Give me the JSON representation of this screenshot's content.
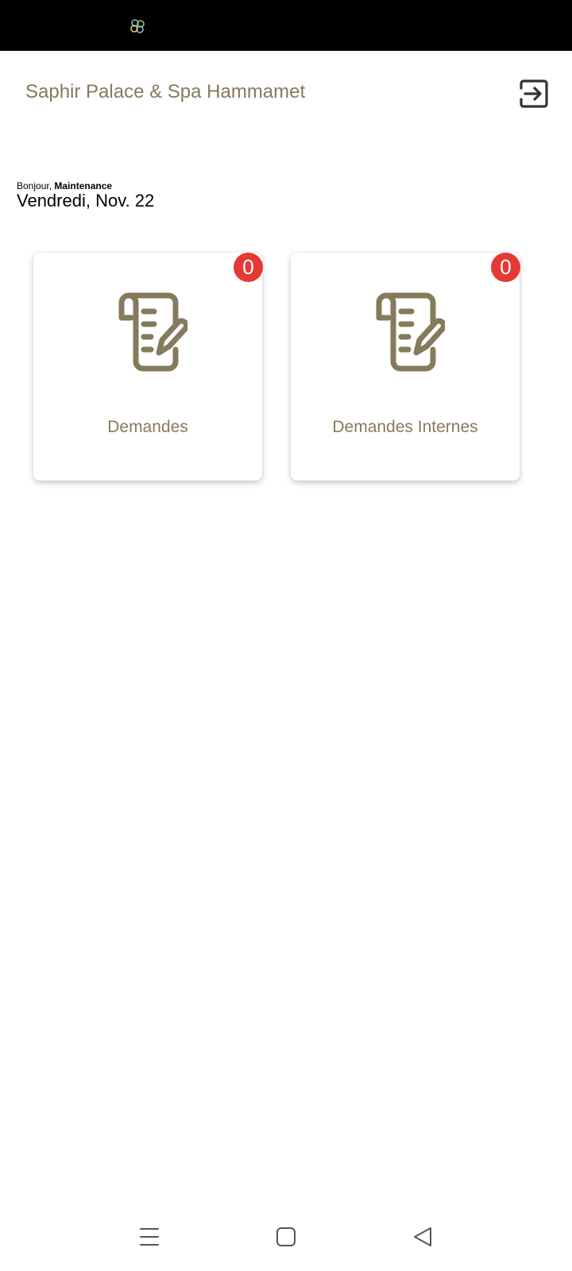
{
  "status_bar": {
    "app_icon": "pinwheel-app-icon"
  },
  "header": {
    "title": "Saphir Palace & Spa Hammamet",
    "logout_icon": "logout-icon"
  },
  "greeting": {
    "prefix": "Bonjour,",
    "name": "Maintenance",
    "date": "Vendredi, Nov. 22"
  },
  "cards": [
    {
      "label": "Demandes",
      "badge": "0",
      "icon": "document-edit-icon"
    },
    {
      "label": "Demandes Internes",
      "badge": "0",
      "icon": "document-edit-icon"
    }
  ],
  "nav": {
    "menu_icon": "menu-icon",
    "home_icon": "home-icon",
    "back_icon": "back-icon"
  },
  "colors": {
    "accent": "#857a5c",
    "badge": "#e53935",
    "status_bar": "#000000"
  }
}
